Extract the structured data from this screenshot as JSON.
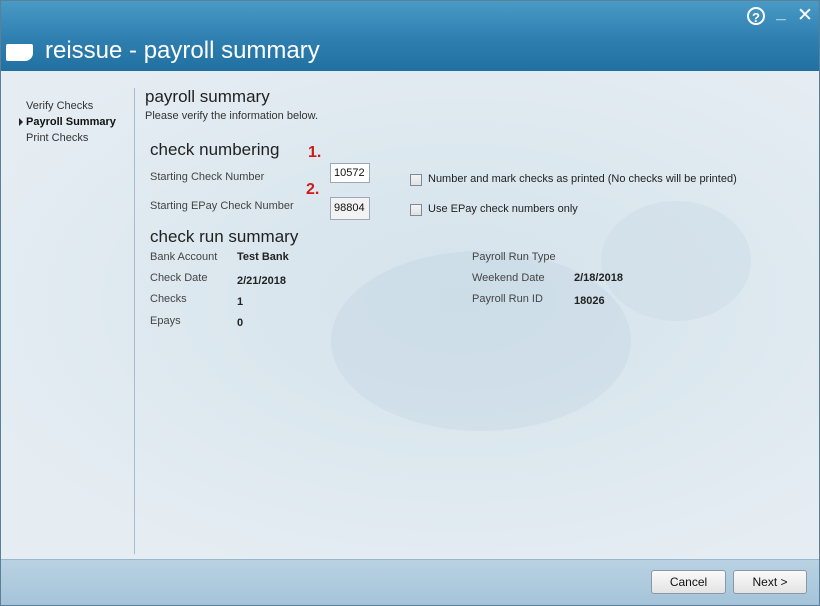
{
  "window": {
    "title": "reissue - payroll summary",
    "help_glyph": "?",
    "minimize_glyph": "_",
    "close_glyph": "✕"
  },
  "nav": {
    "items": [
      {
        "label": "Verify Checks"
      },
      {
        "label": "Payroll Summary",
        "active": true
      },
      {
        "label": "Print Checks"
      }
    ]
  },
  "page": {
    "heading": "payroll summary",
    "subtext": "Please verify the information below."
  },
  "check_numbering": {
    "heading": "check numbering",
    "marker1": "1.",
    "marker2": "2.",
    "starting_check_label": "Starting Check Number",
    "starting_check_value": "10572",
    "starting_epay_label": "Starting EPay Check Number",
    "starting_epay_value": "98804",
    "opt_mark_label": "Number and mark checks as printed (No checks will be printed)",
    "opt_epay_label": "Use EPay check numbers only"
  },
  "summary": {
    "heading": "check run summary",
    "left": [
      {
        "label": "Bank Account",
        "value": "Test Bank"
      },
      {
        "label": "Check Date",
        "value": "2/21/2018"
      },
      {
        "label": "Checks",
        "value": "1"
      },
      {
        "label": "Epays",
        "value": "0"
      }
    ],
    "right": [
      {
        "label": "Payroll Run Type",
        "value": ""
      },
      {
        "label": "Weekend Date",
        "value": "2/18/2018"
      },
      {
        "label": "Payroll Run ID",
        "value": "18026"
      }
    ]
  },
  "footer": {
    "cancel_label": "Cancel",
    "next_label": "Next >"
  },
  "colors": {
    "titlebar": "#2e7fb0",
    "marker": "#d01818",
    "footer": "#a4c3d9"
  }
}
